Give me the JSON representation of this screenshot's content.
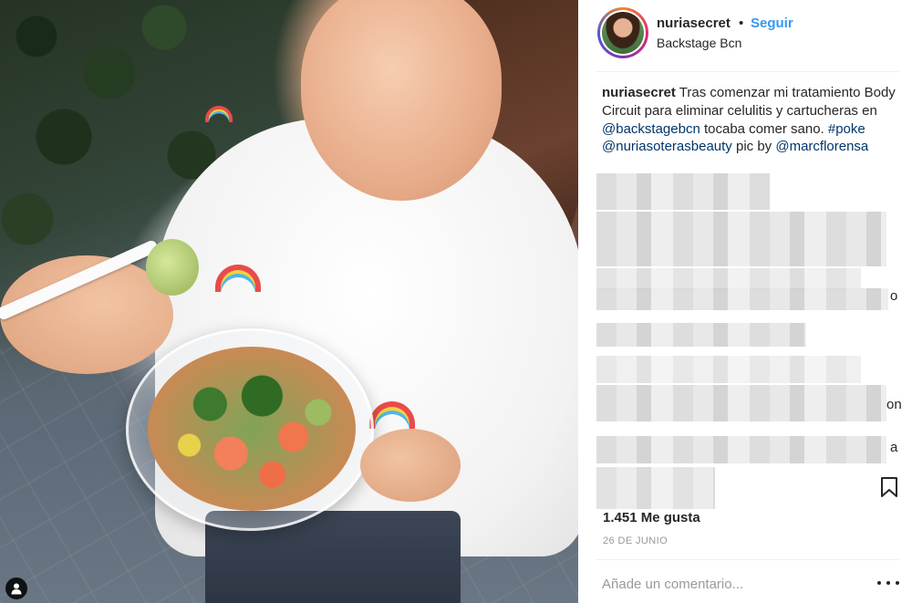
{
  "post": {
    "username": "nuriasecret",
    "separator": "•",
    "follow_label": "Seguir",
    "location": "Backstage Bcn"
  },
  "caption": {
    "username": "nuriasecret",
    "text_1": " Tras comenzar mi tratamiento Body Circuit para eliminar celulitis y cartucheras en ",
    "mention_1": "@backstagebcn",
    "text_2": " tocaba comer sano. ",
    "hashtag_1": "#poke",
    "text_3": " ",
    "mention_2": "@nuriasoterasbeauty",
    "text_4": " pic by ",
    "mention_3": "@marcflorensa"
  },
  "blurred_fragments": [
    "o",
    "on",
    "a"
  ],
  "likes": "1.451 Me gusta",
  "date": "26 DE JUNIO",
  "comment": {
    "placeholder": "Añade un comentario..."
  },
  "colors": {
    "follow": "#3897f0",
    "link": "#003569",
    "muted": "#999999",
    "text": "#262626"
  },
  "icons": {
    "user_tag": "user-tag-icon",
    "bookmark": "bookmark-icon",
    "more": "more-options-icon"
  }
}
